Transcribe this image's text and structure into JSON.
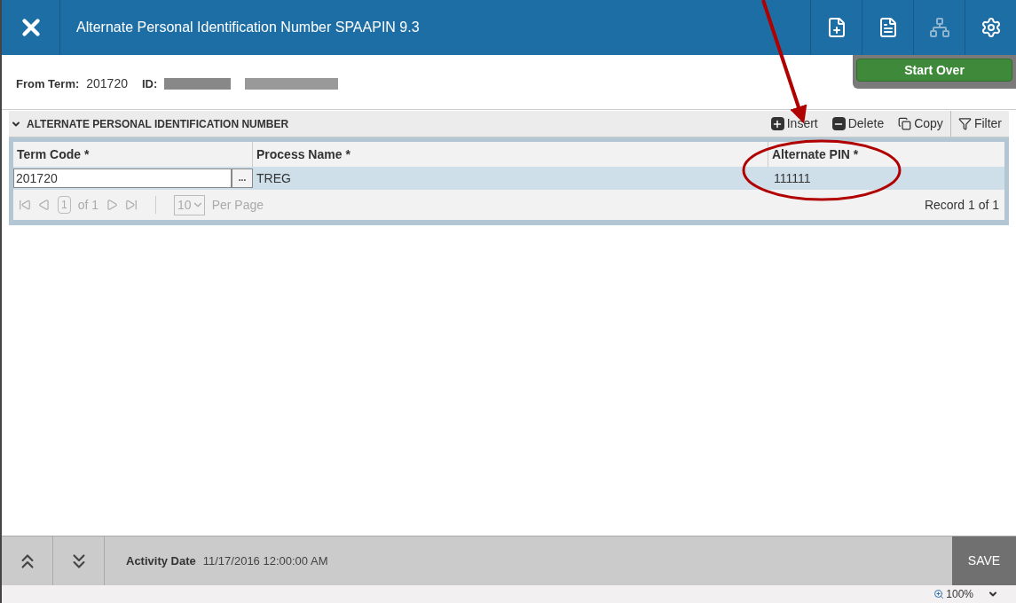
{
  "window": {
    "title": "Alternate Personal Identification Number SPAAPIN 9.3"
  },
  "key_block": {
    "from_term_label": "From Term:",
    "from_term_value": "201720",
    "id_label": "ID:",
    "id_redacted": true
  },
  "start_over": "Start Over",
  "section": {
    "title": "ALTERNATE PERSONAL IDENTIFICATION NUMBER",
    "expanded": true,
    "actions": [
      {
        "kind": "insert",
        "label": "Insert"
      },
      {
        "kind": "delete",
        "label": "Delete"
      },
      {
        "kind": "copy",
        "label": "Copy"
      },
      {
        "kind": "filter",
        "label": "Filter"
      }
    ]
  },
  "table": {
    "columns": [
      "Term Code *",
      "Process Name  *",
      "Alternate PIN *"
    ],
    "lookup": "...",
    "rows": [
      {
        "term_code": "201720",
        "process_name": "TREG",
        "alternate_pin": "111111",
        "selected": true
      }
    ]
  },
  "pager": {
    "page": "1",
    "of": "of 1",
    "per_page": "10",
    "per_page_label": "Per Page",
    "record": "Record 1 of 1"
  },
  "footer": {
    "activity_label": "Activity Date",
    "activity_value": "11/17/2016 12:00:00 AM",
    "save": "SAVE"
  },
  "status": {
    "zoom": "100%"
  }
}
